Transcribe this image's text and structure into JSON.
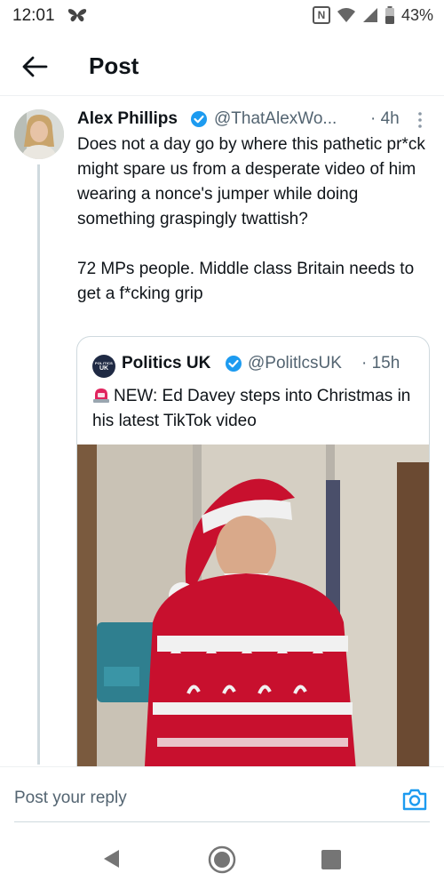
{
  "status_bar": {
    "time": "12:01",
    "battery_percent": "43%",
    "nfc_glyph": "N",
    "icons": [
      "butterfly-icon",
      "nfc-icon",
      "wifi-icon",
      "signal-icon",
      "battery-icon"
    ]
  },
  "header": {
    "title": "Post",
    "back_icon": "arrow-left-icon"
  },
  "tweet": {
    "author_name": "Alex Phillips",
    "handle": "@ThatAlexWo...",
    "time": "· 4h",
    "paragraph_1": "Does not a day go by where this pathetic pr*ck might spare us from a desperate video of him wearing a nonce's jumper while doing something graspingly twattish?",
    "paragraph_2": "72 MPs people. Middle class Britain needs to get a f*cking grip"
  },
  "quote": {
    "author_name": "Politics UK",
    "handle": "@PolitlcsUK",
    "time": "· 15h",
    "avatar_text": "UK",
    "avatar_small_text": "POLITICS",
    "text": "NEW: Ed Davey steps into Christmas in his latest TikTok video",
    "media": "video-thumbnail"
  },
  "reply": {
    "placeholder": "Post your reply",
    "camera_icon": "camera-icon"
  },
  "colors": {
    "text_primary": "#0f1419",
    "text_secondary": "#536471",
    "accent": "#1d9bf0",
    "divider": "#cfd9de"
  }
}
